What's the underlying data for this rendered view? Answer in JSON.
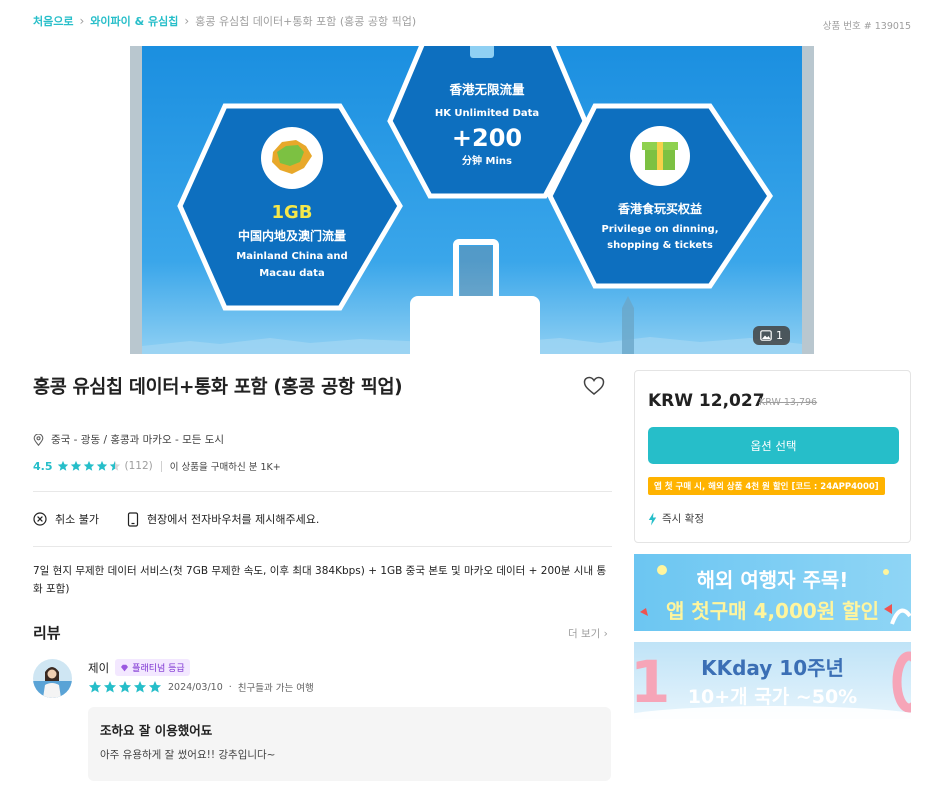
{
  "breadcrumb": {
    "home": "처음으로",
    "category": "와이파이 & 유심칩",
    "current": "홍콩 유심칩 데이터+통화 포함 (홍콩 공항 픽업)"
  },
  "product_number": "상품 번호 # 139015",
  "hero": {
    "center_title": "香港无限流量",
    "center_sub": "HK Unlimited Data",
    "center_big": "+200",
    "center_unit": "分钟 Mins",
    "left_big": "1GB",
    "left_title": "中国内地及澳门流量",
    "left_sub1": "Mainland China and",
    "left_sub2": "Macau data",
    "right_title": "香港食玩买权益",
    "right_sub1": "Privilege on dinning,",
    "right_sub2": "shopping & tickets",
    "photo_count": "1"
  },
  "product": {
    "title": "홍콩 유심칩 데이터+통화 포함 (홍콩 공항 픽업)",
    "location": "중국 - 광동 / 홍콩과 마카오 - 모든 도시",
    "rating": "4.5",
    "rating_value": 4.5,
    "review_count": "(112)",
    "booked": "이 상품을 구매하신 분 1K+",
    "policy_cancel": "취소 불가",
    "policy_voucher": "현장에서 전자바우처를 제시해주세요.",
    "description": "7일 현지 무제한 데이터 서비스(첫 7GB 무제한 속도, 이후 최대 384Kbps) + 1GB 중국 본토 및 마카오 데이터 + 200분 시내 통화 포함)"
  },
  "reviews": {
    "heading": "리뷰",
    "more": "더 보기",
    "items": [
      {
        "name": "제이",
        "badge": "플래티넘 등급",
        "stars": 5,
        "date": "2024/03/10",
        "trip_type": "친구들과 가는 여행",
        "title": "조하요 잘 이용했어됴",
        "body": "아주 유용하게 잘 썼어요!! 강추입니다~"
      }
    ]
  },
  "booking": {
    "price": "KRW 12,027",
    "original_price": "KRW 13,796",
    "select_button": "옵션 선택",
    "promo": "앱 첫 구매 시, 해외 상품 4천 원 할인 [코드 : 24APP4000]",
    "instant": "즉시 확정"
  },
  "banners": [
    {
      "line1": "해외 여행자 주목!",
      "line2": "앱 첫구매 4,000원 할인"
    },
    {
      "line1": "KKday 10주년",
      "line2": "10+개 국가 ~50%"
    }
  ],
  "colors": {
    "accent": "#26bec9",
    "star": "#26bec9",
    "promo": "#ffb300",
    "badge": "#7b2fd1"
  }
}
